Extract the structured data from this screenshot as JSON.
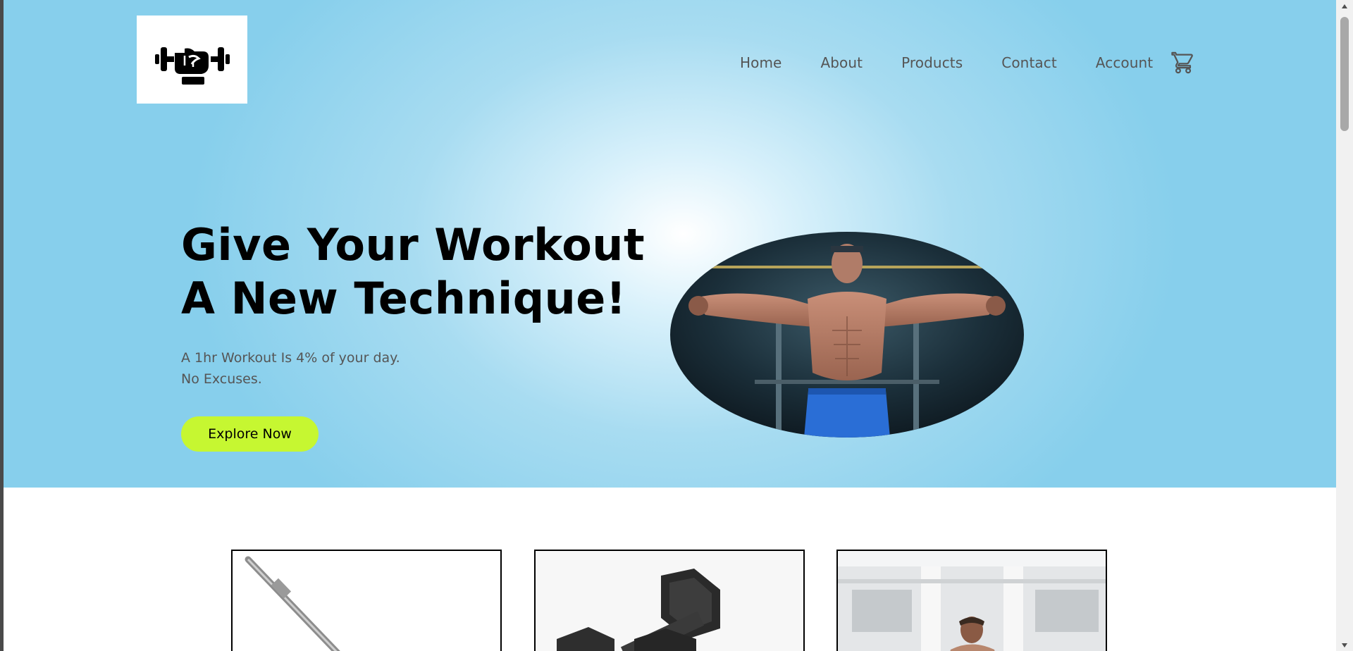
{
  "header": {
    "logo_icon": "dumbbell-fist-icon",
    "nav": [
      {
        "label": "Home"
      },
      {
        "label": "About"
      },
      {
        "label": "Products"
      },
      {
        "label": "Contact"
      },
      {
        "label": "Account"
      }
    ],
    "cart_icon": "shopping-cart-icon"
  },
  "hero": {
    "headline_line1": "Give Your Workout",
    "headline_line2": "A New Technique!",
    "subtext_line1": "A 1hr Workout Is 4% of your day.",
    "subtext_line2": "No Excuses.",
    "cta_label": "Explore Now",
    "image": "bodybuilder-cable-photo"
  },
  "products": {
    "cards": [
      {
        "image": "barbell-photo"
      },
      {
        "image": "dumbbells-photo"
      },
      {
        "image": "gym-man-photo"
      }
    ]
  },
  "colors": {
    "hero_bg": "#87cfec",
    "cta_bg": "#c6f731",
    "nav_text": "#555555"
  }
}
